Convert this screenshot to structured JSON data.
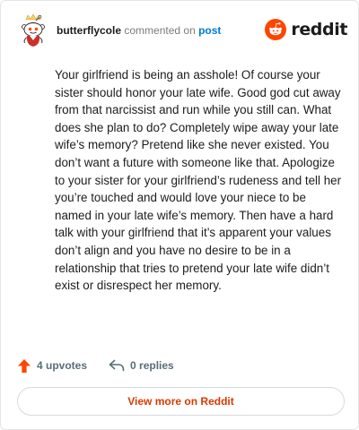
{
  "header": {
    "username": "butterflycole",
    "action_text": "commented on",
    "post_link": "post",
    "logo_text": "reddit"
  },
  "comment": {
    "body": "Your girlfriend is being an asshole! Of course your sister should honor your late wife. Good god cut away from that narcissist and run while you still can. What does she plan to do? Completely wipe away your late wife’s memory? Pretend like she never existed. You don’t want a future with someone like that. Apologize to your sister for your girlfriend’s rudeness and tell her you’re touched and would love your niece to be named in your late wife’s memory. Then have a hard talk with your girlfriend that it’s apparent your values don’t align and you have no desire to be in a relationship that tries to pretend your late wife didn’t exist or disrespect her memory."
  },
  "actions": {
    "upvotes": "4 upvotes",
    "replies": "0 replies",
    "upvote_icon": "upvote-arrow-icon",
    "reply_icon": "reply-arrow-icon"
  },
  "footer": {
    "view_more_label": "View more on Reddit"
  },
  "colors": {
    "brand": "#ff4500",
    "link": "#0079d3",
    "view_more": "#d93a00",
    "muted": "#576f76"
  }
}
